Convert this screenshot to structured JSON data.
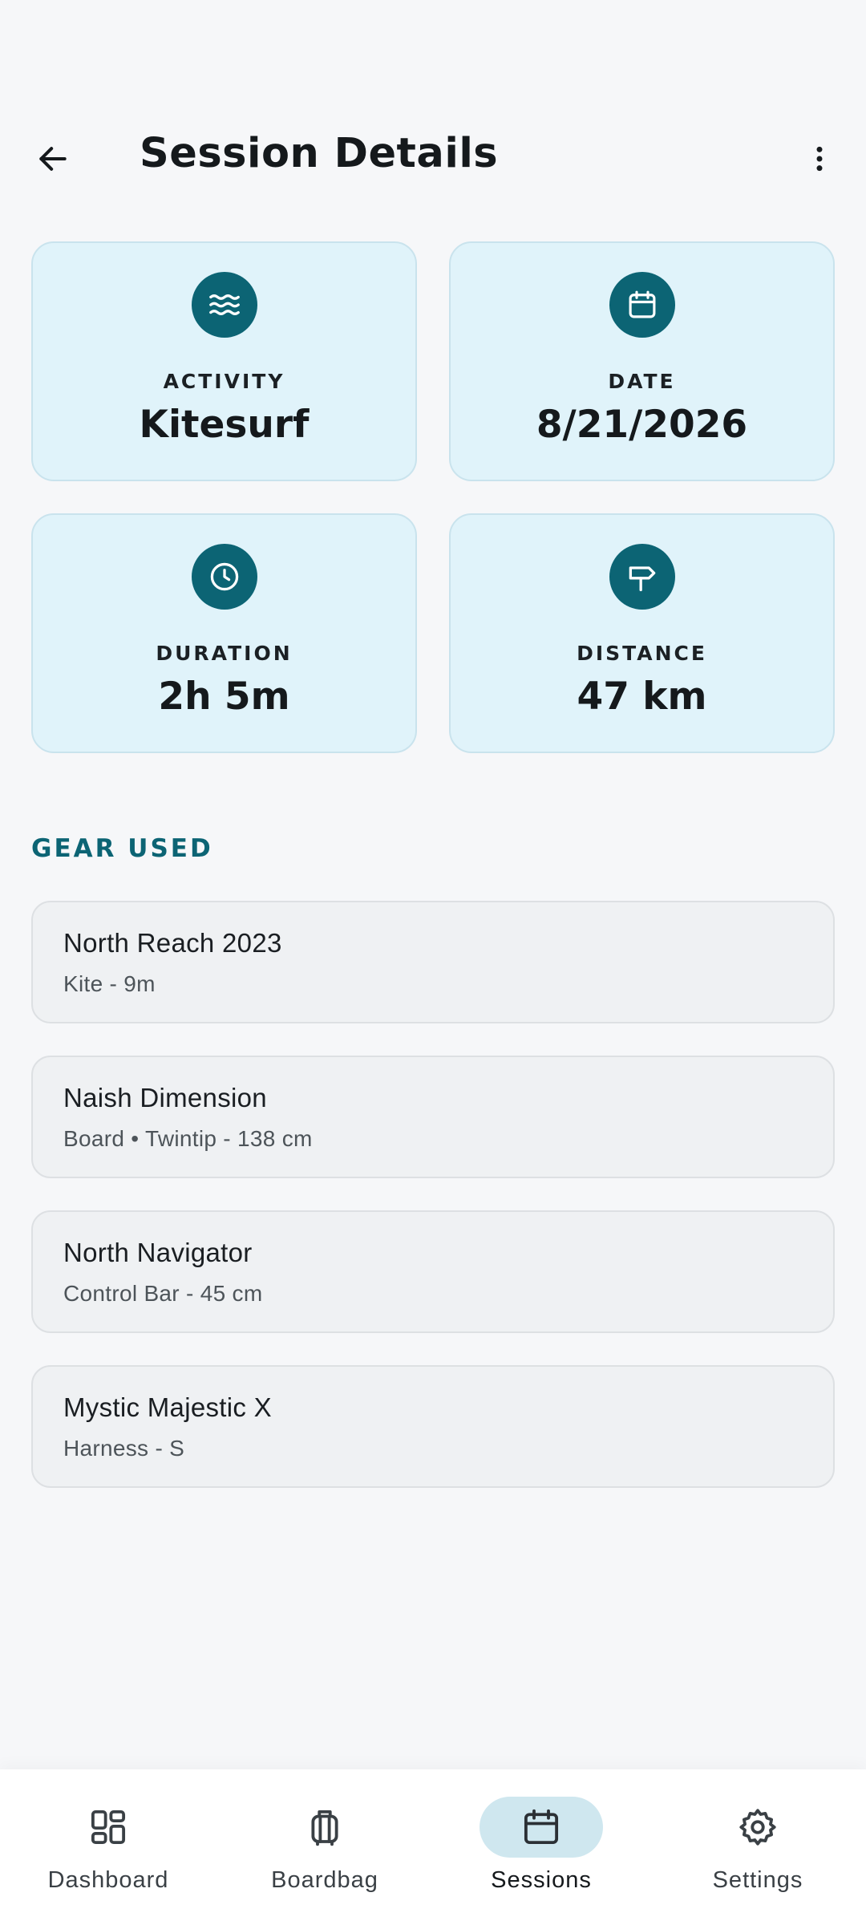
{
  "header": {
    "title": "Session Details"
  },
  "stats": [
    {
      "icon": "waves-icon",
      "label": "ACTIVITY",
      "value": "Kitesurf"
    },
    {
      "icon": "calendar-icon",
      "label": "DATE",
      "value": "8/21/2026"
    },
    {
      "icon": "clock-icon",
      "label": "DURATION",
      "value": "2h 5m"
    },
    {
      "icon": "signpost-icon",
      "label": "DISTANCE",
      "value": "47 km"
    }
  ],
  "gear": {
    "title": "GEAR USED",
    "items": [
      {
        "name": "North Reach 2023",
        "desc": "Kite - 9m"
      },
      {
        "name": "Naish Dimension",
        "desc": "Board • Twintip - 138 cm"
      },
      {
        "name": "North Navigator",
        "desc": "Control Bar - 45 cm"
      },
      {
        "name": "Mystic Majestic X",
        "desc": "Harness - S"
      }
    ]
  },
  "nav": {
    "items": [
      {
        "label": "Dashboard",
        "icon": "dashboard-icon",
        "active": false
      },
      {
        "label": "Boardbag",
        "icon": "luggage-icon",
        "active": false
      },
      {
        "label": "Sessions",
        "icon": "calendar-icon",
        "active": true
      },
      {
        "label": "Settings",
        "icon": "gear-icon",
        "active": false
      }
    ]
  },
  "colors": {
    "accent": "#0c6474",
    "card_bg": "#e0f3fa",
    "active_pill": "#cfe7ef",
    "background": "#f6f7f9"
  }
}
